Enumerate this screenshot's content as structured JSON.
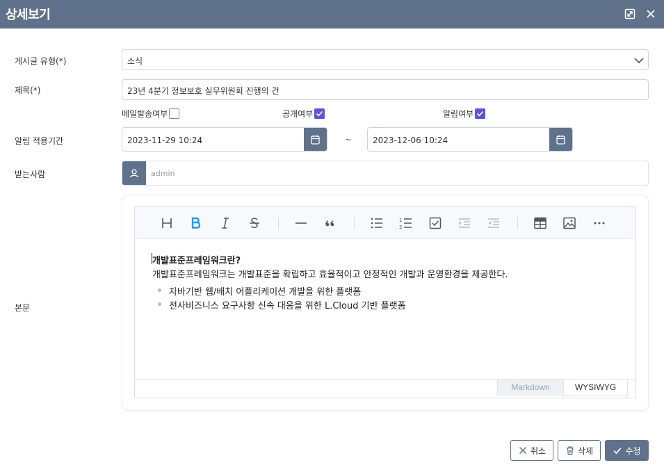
{
  "dialog": {
    "title": "상세보기"
  },
  "form": {
    "category": {
      "label": "게시글 유형(*)",
      "value": "소식"
    },
    "subject": {
      "label": "제목(*)",
      "value": "23년 4분기 정보보호 실무위원회 진행의 건"
    },
    "options": [
      {
        "label": "메일발송여부",
        "checked": false
      },
      {
        "label": "공개여부",
        "checked": true
      },
      {
        "label": "알림여부",
        "checked": true
      }
    ],
    "notify_period": {
      "label": "알림 적용기간",
      "start": "2023-11-29 10:24",
      "separator": "~",
      "end": "2023-12-06 10:24"
    },
    "recipient": {
      "label": "받는사람",
      "value": "admin"
    },
    "body": {
      "label": "본문"
    }
  },
  "editor": {
    "toolbar": [
      "heading",
      "bold",
      "italic",
      "strike",
      "hr",
      "quote",
      "bullet-list",
      "ordered-list",
      "task-list",
      "indent",
      "outdent",
      "table",
      "image",
      "more"
    ],
    "content": {
      "heading": "개발표준프레임워크란?",
      "paragraph": "개발표준프레임워크는 개발표준을 확립하고 효율적이고 안정적인 개발과 운영환경을 제공한다.",
      "items": [
        "자바기반 웹/배치 어플리케이션 개발을 위한 플랫폼",
        "전사비즈니스 요구사항 신속 대응을 위한 L.Cloud 기반 플랫폼"
      ]
    },
    "modes": {
      "markdown": "Markdown",
      "wysiwyg": "WYSIWYG"
    }
  },
  "actions": {
    "cancel": "취소",
    "delete": "삭제",
    "save": "수정"
  },
  "colors": {
    "header": "#5f718b",
    "checkbox_checked": "#5a55d9",
    "bold_active": "#1e9be8"
  }
}
